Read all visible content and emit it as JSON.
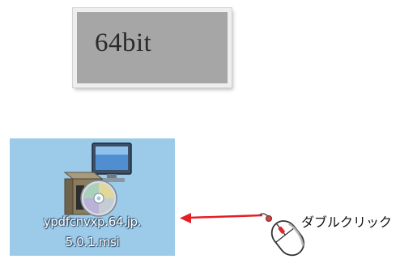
{
  "badge": {
    "label": "64bit",
    "background": "#a6a6a6"
  },
  "file": {
    "name_line1": "ypdfcnvxp.64.jp.",
    "name_line2": "5.0.1.msi",
    "icon": "installer-package-icon",
    "selection_color": "#9ccbe9"
  },
  "annotation": {
    "arrow_icon": "left-arrow-icon",
    "arrow_color": "#e41f26",
    "mouse_icon": "mouse-icon",
    "label": "ダブルクリック"
  }
}
